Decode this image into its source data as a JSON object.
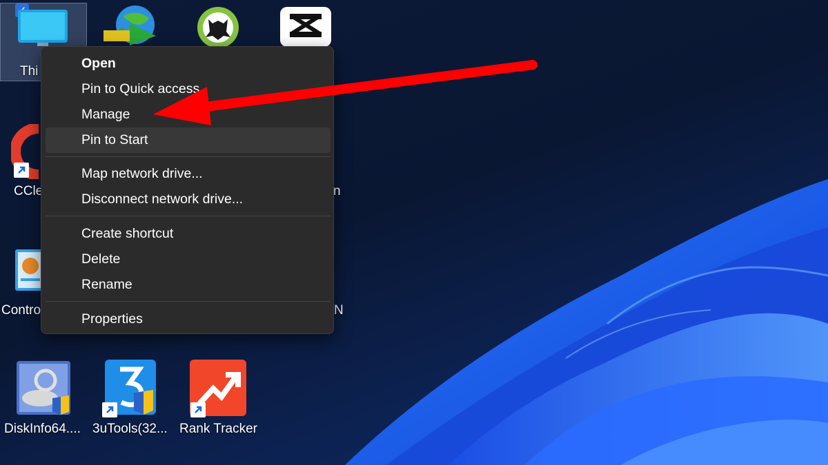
{
  "desktop": {
    "icons": [
      {
        "id": "this-pc",
        "label": "Thi",
        "selected": true
      },
      {
        "id": "idm",
        "label": ""
      },
      {
        "id": "screaming-frog",
        "label": ""
      },
      {
        "id": "capcut",
        "label": ""
      },
      {
        "id": "ccleaner",
        "label": "CCle"
      },
      {
        "id": "control-panel",
        "label": "Contro"
      },
      {
        "id": "diskinfo",
        "label": "DiskInfo64...."
      },
      {
        "id": "3utools",
        "label": "3uTools(32..."
      },
      {
        "id": "rank-tracker",
        "label": "Rank Tracker"
      }
    ],
    "partial_labels": [
      "n",
      "N"
    ]
  },
  "context_menu": {
    "groups": [
      [
        {
          "label": "Open",
          "bold": true
        },
        {
          "label": "Pin to Quick access"
        },
        {
          "label": "Manage"
        },
        {
          "label": "Pin to Start",
          "highlighted": true
        }
      ],
      [
        {
          "label": "Map network drive..."
        },
        {
          "label": "Disconnect network drive..."
        }
      ],
      [
        {
          "label": "Create shortcut"
        },
        {
          "label": "Delete"
        },
        {
          "label": "Rename"
        }
      ],
      [
        {
          "label": "Properties"
        }
      ]
    ]
  },
  "colors": {
    "menu_bg": "#2b2b2b",
    "menu_hover": "#383838",
    "annotation_arrow": "#ff0000",
    "wallpaper_blue": "#1f5cf0"
  }
}
